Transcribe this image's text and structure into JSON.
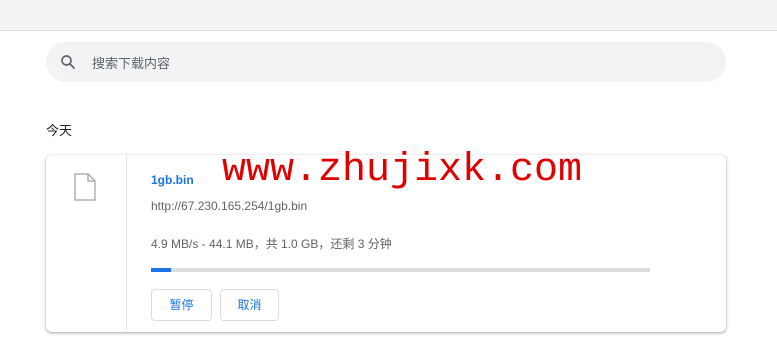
{
  "search": {
    "placeholder": "搜索下载内容",
    "value": ""
  },
  "section_title": "今天",
  "download": {
    "filename": "1gb.bin",
    "url": "http://67.230.165.254/1gb.bin",
    "status": "4.9 MB/s - 44.1 MB，共 1.0 GB，还剩 3 分钟",
    "progress_fraction": 0.04,
    "pause_label": "暂停",
    "cancel_label": "取消"
  },
  "watermark": "www.zhujixk.com",
  "colors": {
    "accent": "#1a73e8",
    "watermark": "#e00000"
  },
  "icons": {
    "search": "search-icon",
    "file": "file-icon"
  }
}
